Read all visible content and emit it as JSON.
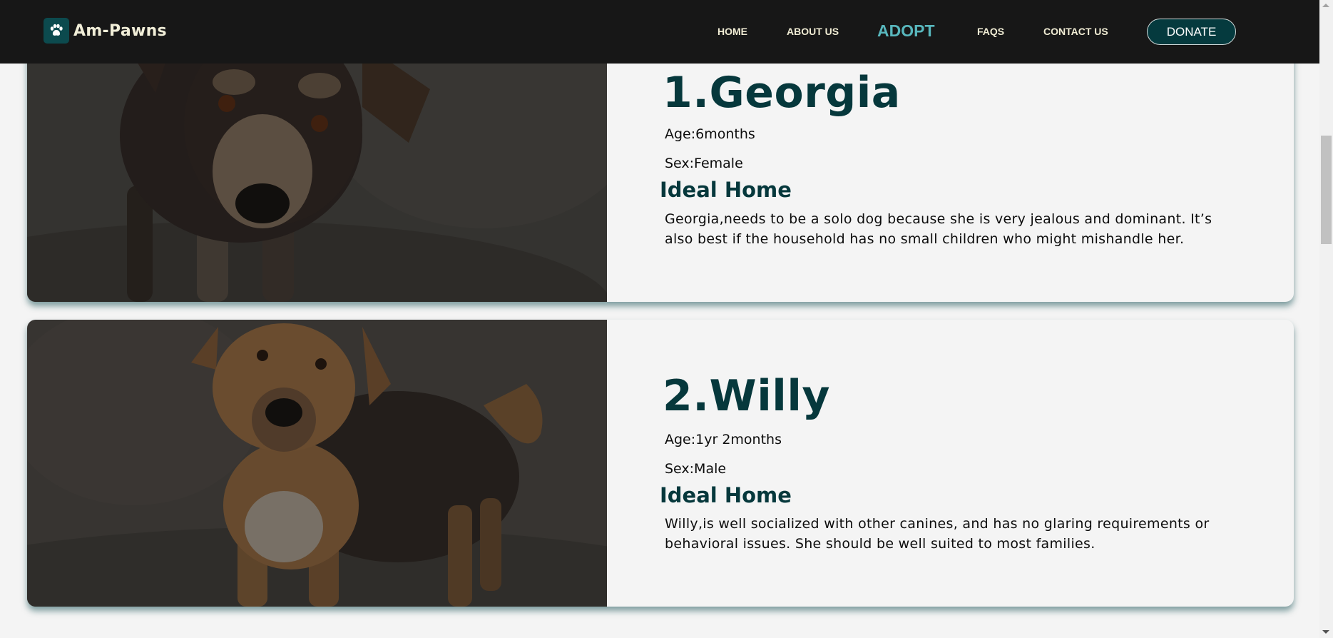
{
  "nav": {
    "brand": "Am-Pawns",
    "links": [
      "HOME",
      "ABOUT US",
      "ADOPT",
      "FAQS",
      "CONTACT US"
    ],
    "active": "ADOPT",
    "donate": "DONATE"
  },
  "dogs": [
    {
      "name": "1.Georgia",
      "age": "Age:6months",
      "sex": "Sex:Female",
      "ideal_heading": "Ideal Home",
      "ideal_text": "Georgia,needs to be a solo dog because she is very jealous and dominant. It’s also best if the household has no small children who might mishandle her."
    },
    {
      "name": "2.Willy",
      "age": "Age:1yr 2months",
      "sex": "Sex:Male",
      "ideal_heading": "Ideal Home",
      "ideal_text": "Willy,is well socialized with other canines, and has no glaring requirements or behavioral issues. She should be well suited to most families."
    }
  ],
  "colors": {
    "navbar": "#171717",
    "brand_teal": "#06383c",
    "active_link": "#58b7bd",
    "card_bg": "#f4f4f4"
  }
}
